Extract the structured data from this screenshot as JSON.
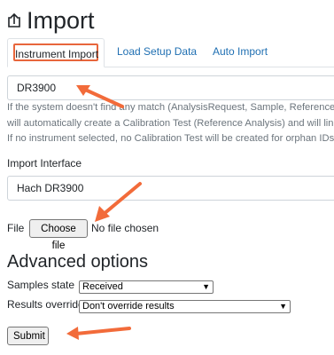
{
  "header": {
    "title": "Import",
    "icon": "import-icon"
  },
  "tabs": [
    {
      "label": "Instrument Import",
      "active": true
    },
    {
      "label": "Load Setup Data",
      "active": false
    },
    {
      "label": "Auto Import",
      "active": false
    }
  ],
  "instrument": {
    "value": "DR3900",
    "help_lines": [
      "If the system doesn't find any match (AnalysisRequest, Sample, Reference",
      "will automatically create a Calibration Test (Reference Analysis) and will lin",
      "If no instrument selected, no Calibration Test will be created for orphan IDs"
    ]
  },
  "interface": {
    "label": "Import Interface",
    "value": "Hach DR3900"
  },
  "file": {
    "label": "File",
    "button_label": "Choose file",
    "status": "No file chosen"
  },
  "advanced": {
    "title": "Advanced options",
    "samples_state": {
      "label": "Samples state",
      "value": "Received"
    },
    "results_override": {
      "label": "Results override",
      "value": "Don't override results"
    }
  },
  "submit": {
    "label": "Submit"
  },
  "colors": {
    "accent": "#e8663c",
    "link": "#1f6fb2"
  }
}
